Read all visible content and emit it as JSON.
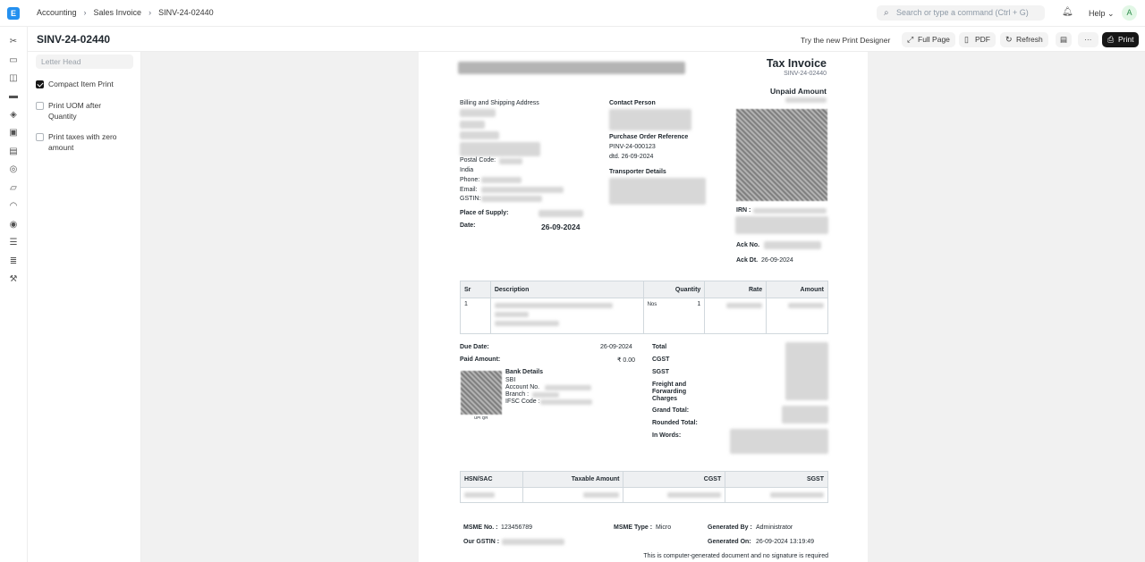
{
  "topbar": {
    "logo": "E",
    "breadcrumbs": [
      "Accounting",
      "Sales Invoice",
      "SINV-24-02440"
    ],
    "search_placeholder": "Search or type a command (Ctrl + G)",
    "help_label": "Help",
    "avatar_initial": "A"
  },
  "page": {
    "title": "SINV-24-02440",
    "try_print_designer": "Try the new Print Designer",
    "buttons": {
      "full_page": "Full Page",
      "pdf": "PDF",
      "refresh": "Refresh",
      "more": "···",
      "print": "Print"
    }
  },
  "sidebar": {
    "letter_head_placeholder": "Letter Head",
    "options": [
      {
        "label": "Compact Item Print",
        "checked": true
      },
      {
        "label": "Print UOM after Quantity",
        "checked": false
      },
      {
        "label": "Print taxes with zero amount",
        "checked": false
      }
    ]
  },
  "invoice": {
    "doc_type": "Tax Invoice",
    "doc_no": "SINV-24-02440",
    "unpaid_label": "Unpaid Amount",
    "billing_label": "Billing and Shipping Address",
    "postal_label": "Postal Code:",
    "country": "India",
    "phone_label": "Phone:",
    "email_label": "Email:",
    "gstin_label": "GSTIN:",
    "place_of_supply_label": "Place of Supply:",
    "date_label": "Date:",
    "date_value": "26-09-2024",
    "contact_label": "Contact Person",
    "po_label": "Purchase Order Reference",
    "po_no": "PINV-24-000123",
    "po_date": "dtd. 26-09-2024",
    "transporter_label": "Transporter Details",
    "irn_label": "IRN :",
    "ack_no_label": "Ack No.",
    "ack_dt_label": "Ack Dt.",
    "ack_dt_value": "26-09-2024",
    "items_headers": [
      "Sr",
      "Description",
      "Quantity",
      "Rate",
      "Amount"
    ],
    "items": [
      {
        "sr": "1",
        "uom": "Nos",
        "qty": "1"
      }
    ],
    "due_date_label": "Due Date:",
    "due_date_value": "26-09-2024",
    "paid_label": "Paid Amount:",
    "paid_value": "₹ 0.00",
    "bank_title": "Bank Details",
    "bank_name": "SBI",
    "account_label": "Account No.",
    "branch_label": "Branch :",
    "ifsc_label": "IFSC Code :",
    "upi_label": "UPI QR",
    "totals_labels": [
      "Total",
      "CGST",
      "SGST",
      "Freight and Forwarding Charges",
      "Grand Total:",
      "Rounded Total:",
      "In Words:"
    ],
    "tax_headers": [
      "HSN/SAC",
      "Taxable Amount",
      "CGST",
      "SGST"
    ],
    "msme_no_label": "MSME No. :",
    "msme_no_value": "123456789",
    "msme_type_label": "MSME Type :",
    "msme_type_value": "Micro",
    "generated_by_label": "Generated By :",
    "generated_by_value": "Administrator",
    "our_gstin_label": "Our GSTIN :",
    "generated_on_label": "Generated On:",
    "generated_on_value": "26-09-2024 13:19:49",
    "footer_note": "This is computer-generated document and no signature is required"
  },
  "icons": [
    "tools-icon",
    "money-icon",
    "bag-icon",
    "card-icon",
    "box-icon",
    "truck-icon",
    "factory-icon",
    "settings-icon",
    "folder-icon",
    "headset-icon",
    "target-icon",
    "server-icon",
    "layers-icon",
    "wrench-icon"
  ]
}
